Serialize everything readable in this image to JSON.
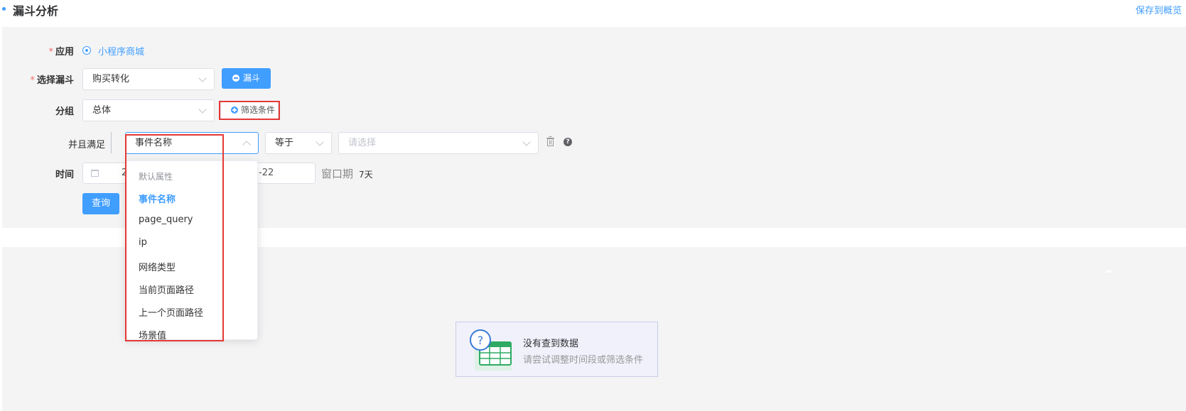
{
  "header": {
    "title": "漏斗分析",
    "save_label": "保存到概览"
  },
  "form": {
    "app_label": "应用",
    "app_value": "小程序商城",
    "funnel_label": "选择漏斗",
    "funnel_value": "购买转化",
    "funnel_button": "漏斗",
    "group_label": "分组",
    "group_value": "总体",
    "filter_button": "筛选条件",
    "condition_label": "并且满足",
    "condition_field": "事件名称",
    "condition_operator": "等于",
    "condition_value_placeholder": "请选择",
    "time_label": "时间",
    "date_start_partial": "2",
    "date_end_partial": "-22",
    "window_label": "窗口期",
    "window_value": "7天",
    "query_button": "查询"
  },
  "dropdown": {
    "group_title": "默认属性",
    "items": [
      "事件名称",
      "page_query",
      "ip",
      "网络类型",
      "当前页面路径",
      "上一个页面路径",
      "场景值"
    ],
    "selected_index": 0
  },
  "empty_state": {
    "title": "没有查到数据",
    "subtitle": "请尝试调整时间段或筛选条件"
  },
  "colors": {
    "primary": "#409eff",
    "required": "#f56c6c",
    "annotation": "#e53935",
    "panel_bg": "#f4f4f5"
  }
}
